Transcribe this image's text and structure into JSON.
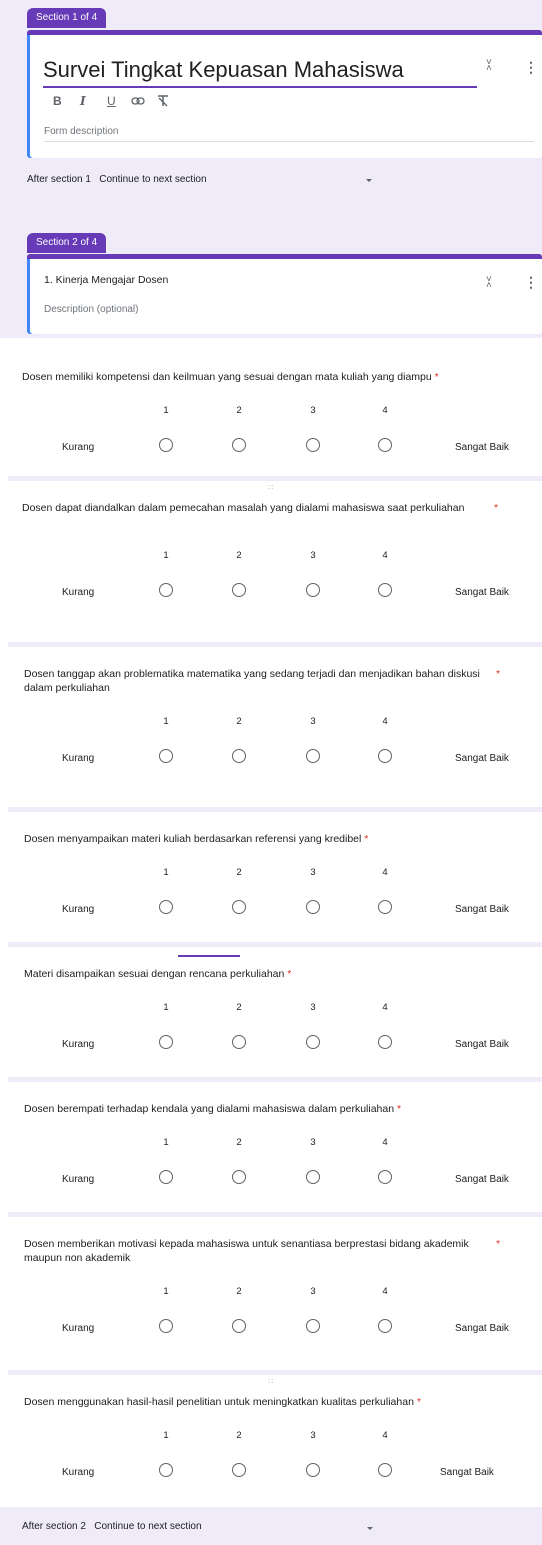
{
  "section1": {
    "tab_label": "Section 1 of 4",
    "title": "Survei Tingkat Kepuasan Mahasiswa",
    "toolbar": {
      "bold": "B",
      "italic": "I",
      "underline": "U",
      "link_icon": "link-icon",
      "clear_format_icon": "clear-format-icon"
    },
    "description_placeholder": "Form description",
    "after_label": "After section 1",
    "after_value": "Continue to next section"
  },
  "section2": {
    "tab_label": "Section 2 of 4",
    "title": "1. Kinerja Mengajar Dosen",
    "description_placeholder": "Description (optional)",
    "after_label": "After section 2",
    "after_value": "Continue to next section"
  },
  "scale": {
    "numbers": [
      "1",
      "2",
      "3",
      "4"
    ],
    "low_label": "Kurang",
    "high_label": "Sangat Baik"
  },
  "questions": [
    {
      "text": "Dosen memiliki kompetensi dan keilmuan yang sesuai dengan mata kuliah yang diampu",
      "required": "*"
    },
    {
      "text": "Dosen dapat diandalkan dalam pemecahan masalah yang dialami mahasiswa saat perkuliahan",
      "required": "*"
    },
    {
      "text": "Dosen tanggap akan problematika matematika yang sedang terjadi dan menjadikan bahan diskusi dalam perkuliahan",
      "required": "*"
    },
    {
      "text": "Dosen menyampaikan materi kuliah berdasarkan referensi yang kredibel",
      "required": "*"
    },
    {
      "text": "Materi disampaikan sesuai dengan rencana perkuliahan",
      "required": "*"
    },
    {
      "text": "Dosen berempati terhadap kendala yang dialami mahasiswa dalam perkuliahan",
      "required": "*"
    },
    {
      "text": "Dosen memberikan motivasi kepada mahasiswa untuk senantiasa berprestasi bidang akademik maupun non akademik",
      "required": "*"
    },
    {
      "text": "Dosen menggunakan hasil-hasil penelitian untuk meningkatkan kualitas perkuliahan",
      "required": "*"
    }
  ],
  "icons": {
    "kebab": "more-vert-icon",
    "collapse": "collapse-icon",
    "drag": "drag-handle-icon",
    "dropdown": "dropdown-caret-icon"
  },
  "colors": {
    "accent": "#673ab7",
    "background": "#f0ebf8",
    "required": "#d93025",
    "focus": "#4285f4"
  }
}
